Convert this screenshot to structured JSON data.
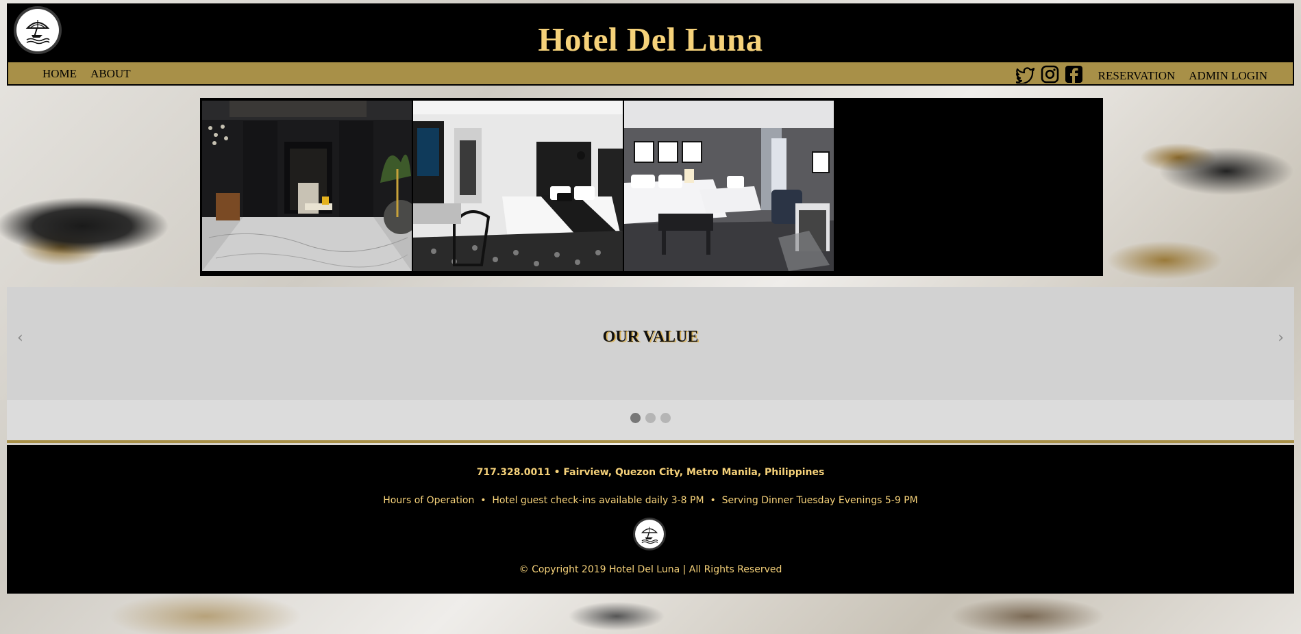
{
  "header": {
    "title": "Hotel Del Luna",
    "logo_icon": "beach-umbrella-logo-icon"
  },
  "nav": {
    "left": [
      {
        "label": "HOME"
      },
      {
        "label": "ABOUT"
      }
    ],
    "social_icons": [
      "twitter-icon",
      "instagram-icon",
      "facebook-icon"
    ],
    "right": [
      {
        "label": "RESERVATION"
      },
      {
        "label": "ADMIN LOGIN"
      }
    ]
  },
  "gallery": {
    "photos": [
      "hotel-hallway-photo",
      "hotel-bedroom-photo",
      "hotel-twin-room-photo"
    ]
  },
  "carousel": {
    "heading": "OUR VALUE",
    "prev_label": "‹",
    "next_label": "›",
    "slide_count": 3,
    "active_index": 0
  },
  "footer": {
    "contact": "717.328.0011 • Fairview, Quezon City, Metro Manila, Philippines",
    "hours": "Hours of Operation  •  Hotel guest check-ins available daily 3-8 PM  •  Serving Dinner Tuesday Evenings 5-9 PM",
    "copyright": "© Copyright 2019 Hotel Del Luna | All Rights Reserved"
  },
  "colors": {
    "gold_text": "#f6d27a",
    "nav_gold": "#a89048",
    "black": "#000000"
  }
}
